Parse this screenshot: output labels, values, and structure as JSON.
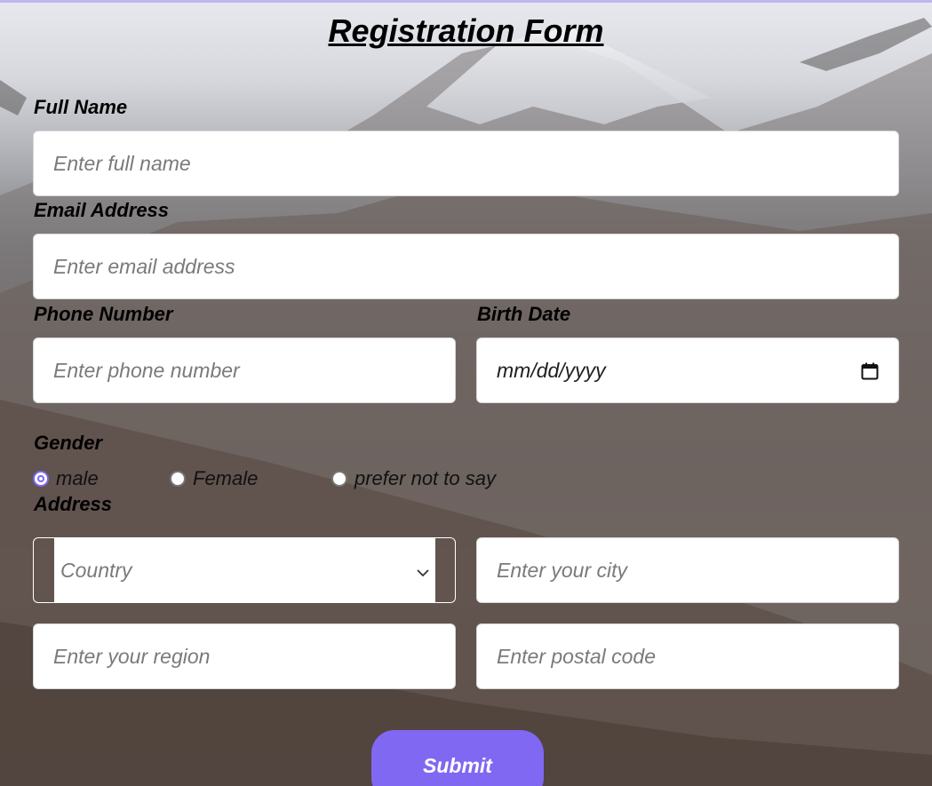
{
  "form": {
    "title": "Registration Form",
    "full_name": {
      "label": "Full Name",
      "placeholder": "Enter full name"
    },
    "email": {
      "label": "Email Address",
      "placeholder": "Enter email address"
    },
    "phone": {
      "label": "Phone Number",
      "placeholder": "Enter phone number"
    },
    "birth_date": {
      "label": "Birth Date",
      "value": "mm/dd/yyyy",
      "icon": "calendar-icon"
    },
    "gender": {
      "label": "Gender",
      "options": [
        "male",
        "Female",
        "prefer not to say"
      ],
      "selected": "male"
    },
    "address": {
      "label": "Address",
      "country": {
        "selected": "Country",
        "icon": "chevron-down-icon"
      },
      "city": {
        "placeholder": "Enter your city"
      },
      "region": {
        "placeholder": "Enter your region"
      },
      "postal": {
        "placeholder": "Enter postal code"
      }
    },
    "submit_label": "Submit"
  },
  "colors": {
    "accent": "#8068f3",
    "top_strip": "#bdb7ee"
  }
}
